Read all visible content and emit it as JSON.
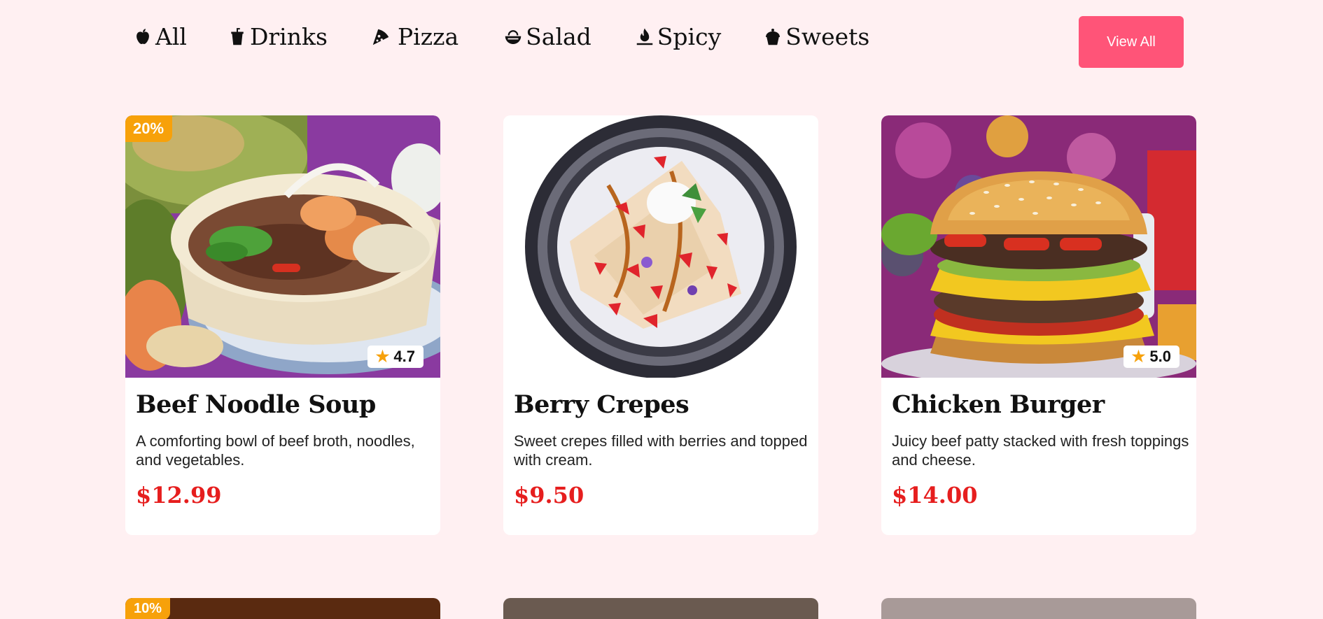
{
  "categories": [
    {
      "label": "All",
      "icon": "apple-icon"
    },
    {
      "label": "Drinks",
      "icon": "cup-icon"
    },
    {
      "label": "Pizza",
      "icon": "pizza-icon"
    },
    {
      "label": "Salad",
      "icon": "bowl-icon"
    },
    {
      "label": "Spicy",
      "icon": "fire-icon"
    },
    {
      "label": "Sweets",
      "icon": "cupcake-icon"
    }
  ],
  "view_all_label": "View All",
  "cards": [
    {
      "badge": "20%",
      "rating": "4.7",
      "title": "Beef Noodle Soup",
      "description": "A comforting bowl of beef broth, noodles, and vegetables.",
      "price": "$12.99"
    },
    {
      "badge": "",
      "rating": "",
      "title": "Berry Crepes",
      "description": "Sweet crepes filled with berries and topped with cream.",
      "price": "$9.50"
    },
    {
      "badge": "",
      "rating": "5.0",
      "title": "Chicken Burger",
      "description": "Juicy beef patty stacked with fresh toppings and cheese.",
      "price": "$14.00"
    }
  ],
  "next_row_badge": "10%",
  "colors": {
    "background": "#fff0f2",
    "accent": "#ff5478",
    "badge": "#f7a10a",
    "price": "#e61e1e"
  }
}
